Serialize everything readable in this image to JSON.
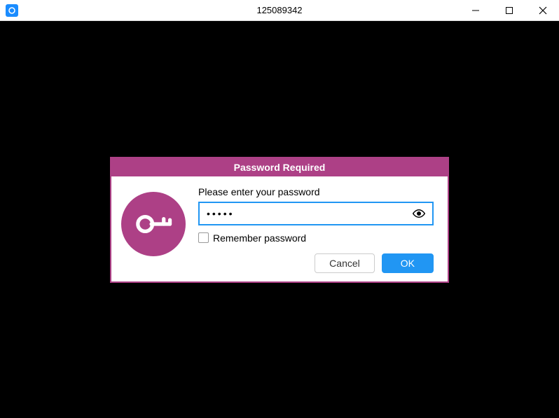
{
  "window": {
    "title": "125089342"
  },
  "dialog": {
    "header": "Password Required",
    "prompt": "Please enter your password",
    "password_value": "•••••",
    "remember_label": "Remember password",
    "remember_checked": false,
    "cancel_label": "Cancel",
    "ok_label": "OK"
  }
}
